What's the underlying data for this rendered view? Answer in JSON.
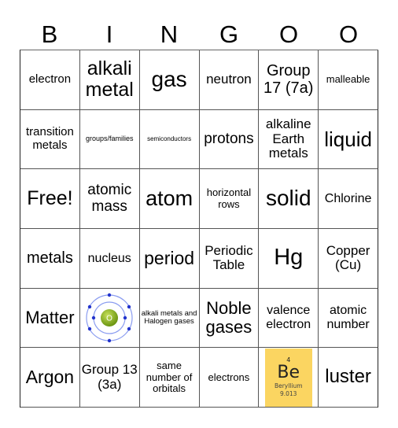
{
  "header": {
    "letters": [
      "B",
      "I",
      "N",
      "G",
      "O",
      "O"
    ]
  },
  "board": {
    "cells": [
      [
        "electron",
        "alkali metal",
        "gas",
        "neutron",
        "Group 17 (7a)",
        "malleable"
      ],
      [
        "transition metals",
        "groups/families",
        "semiconductors",
        "protons",
        "alkaline Earth metals",
        "liquid"
      ],
      [
        "Free!",
        "atomic mass",
        "atom",
        "horizontal rows",
        "solid",
        "Chlorine"
      ],
      [
        "metals",
        "nucleus",
        "period",
        "Periodic Table",
        "Hg",
        "Copper (Cu)"
      ],
      [
        "Matter",
        "",
        "alkali metals and Halogen gases",
        "Noble gases",
        "valence electron",
        "atomic number"
      ],
      [
        "Argon",
        "Group 13 (3a)",
        "same number of orbitals",
        "electrons",
        "",
        "luster"
      ]
    ],
    "atom_image": {
      "icon": "oxygen-atom-diagram-icon",
      "nucleus_label": "O",
      "nucleus_color": "#8db51c",
      "electron_color": "#2233cc",
      "orbit_color": "#8a9cf0"
    },
    "element_tile": {
      "number": "4",
      "symbol": "Be",
      "name": "Beryllium",
      "mass": "9.013",
      "color": "#fbd561"
    }
  }
}
